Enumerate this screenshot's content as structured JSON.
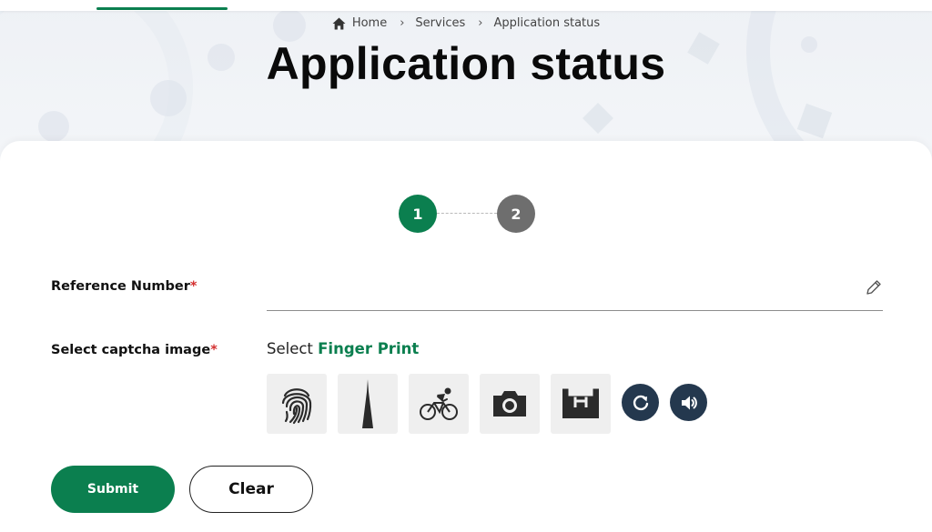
{
  "breadcrumb": {
    "home": "Home",
    "services": "Services",
    "current": "Application status"
  },
  "page": {
    "title": "Application status"
  },
  "stepper": {
    "steps": [
      "1",
      "2"
    ],
    "active": "1"
  },
  "form": {
    "reference_label": "Reference Number",
    "required_mark": "*",
    "reference_value": "",
    "captcha_label": "Select captcha image",
    "captcha_prompt_prefix": "Select",
    "captcha_target": "Finger Print",
    "captcha_options": [
      {
        "icon": "fingerprint-icon"
      },
      {
        "icon": "tower-icon"
      },
      {
        "icon": "cyclist-icon"
      },
      {
        "icon": "camera-icon"
      },
      {
        "icon": "helipad-building-icon"
      }
    ],
    "refresh_icon": "refresh-icon",
    "audio_icon": "speaker-icon"
  },
  "buttons": {
    "submit": "Submit",
    "clear": "Clear"
  },
  "colors": {
    "primary": "#0b7f4f",
    "step_inactive": "#6e6e6e",
    "captcha_action": "#24384e",
    "required": "#d32f2f"
  }
}
